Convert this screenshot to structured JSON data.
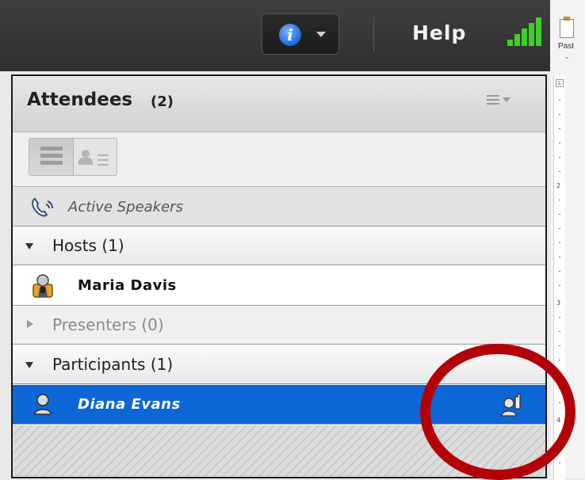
{
  "toolbar": {
    "info_icon": "info-icon",
    "help_label": "Help",
    "signal_icon": "signal-strength-icon"
  },
  "ribbon": {
    "paste_label": "Past",
    "paste_icon": "paste-icon"
  },
  "ruler": {
    "numbers": [
      "2",
      "3",
      "4"
    ]
  },
  "attendees": {
    "title": "Attendees",
    "count": "(2)",
    "active_speakers_label": "Active Speakers",
    "groups": {
      "hosts": "Hosts (1)",
      "presenters": "Presenters (0)",
      "participants": "Participants (1)"
    },
    "hosts": [
      {
        "name": "Maria  Davis",
        "icon": "host-icon"
      }
    ],
    "participants": [
      {
        "name": "Diana Evans",
        "icon": "participant-icon",
        "status_icon": "raise-hand-icon"
      }
    ]
  },
  "colors": {
    "selected_row": "#0d66d6",
    "signal": "#3fcf2a",
    "highlight": "#b30008",
    "topbar": "#363636"
  }
}
